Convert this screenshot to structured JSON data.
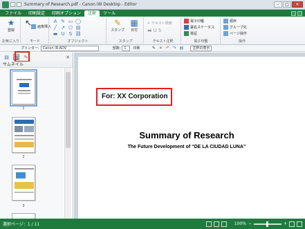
{
  "window": {
    "title": "Summary of Research.pdf - Canon iW Desktop - Editor",
    "min_label": "–",
    "max_label": "□",
    "close_label": "✕"
  },
  "tabs": [
    {
      "label": "ファイル"
    },
    {
      "label": "印刷設定"
    },
    {
      "label": "印刷オプション"
    },
    {
      "label": "注釈"
    },
    {
      "label": "ツール"
    }
  ],
  "ribbon": {
    "groups": {
      "favorites": "お気に入り",
      "mode": "モード",
      "objects": "オブジェクト",
      "stamp": "スタンプ",
      "text_annotation": "テキスト注釈",
      "e_signature": "電子印鑑",
      "operations": "操作"
    },
    "buttons": {
      "register": "登録",
      "image_insert": "画像挿入",
      "stamp": "スタンプ",
      "date": "日付",
      "text_search": "テキスト検索",
      "e_seal": "電子印鑑",
      "signature_status": "署名ステータス",
      "verify": "検証",
      "order": "順序",
      "group": "グループ化",
      "page_operation": "ページ操作"
    }
  },
  "propbar": {
    "printer_label": "プリンター:",
    "printer_value": "Canon iR-ADV",
    "copies_label": "部数:",
    "copies_value": "1",
    "duplex_label": "印刷",
    "show_annotations": "注釈の表示"
  },
  "sidebar": {
    "header": "サムネイル",
    "pages": [
      {
        "number": "1"
      },
      {
        "number": "2"
      },
      {
        "number": "3"
      }
    ]
  },
  "document": {
    "recipient": "For: XX Corporation",
    "title": "Summary of Research",
    "subtitle": "The Future Development of “DE LA CIUDAD LUNA”"
  },
  "status": {
    "page_info": "選択ページ：1 / 11",
    "zoom": "100%"
  }
}
